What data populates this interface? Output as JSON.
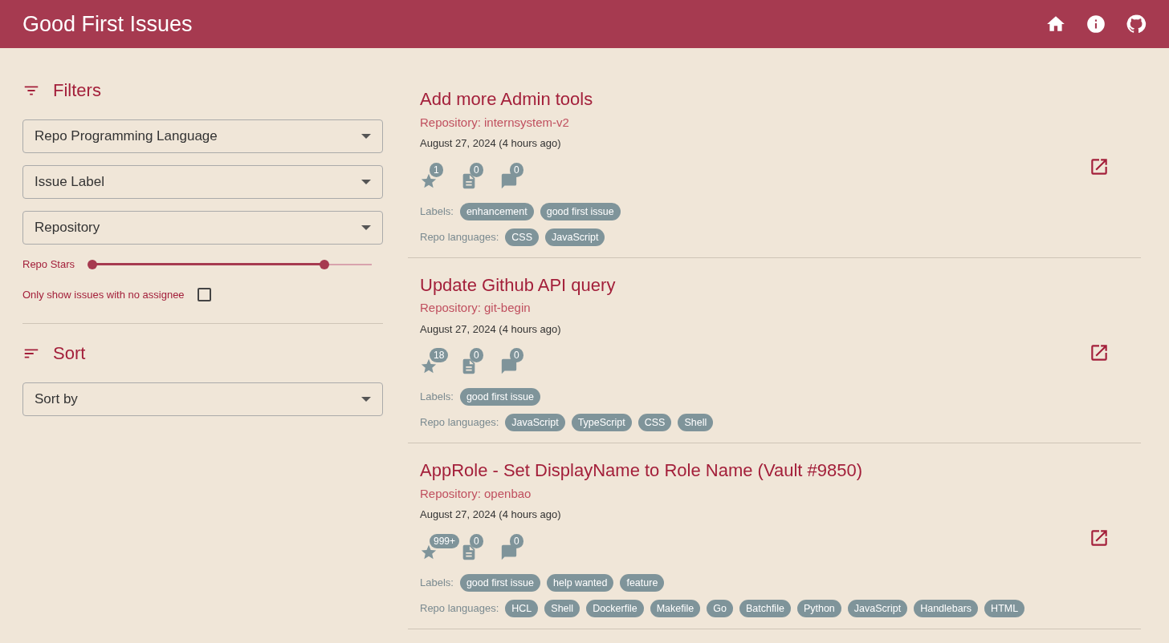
{
  "app_title": "Good First Issues",
  "filters": {
    "title": "Filters",
    "selects": [
      {
        "placeholder": "Repo Programming Language"
      },
      {
        "placeholder": "Issue Label"
      },
      {
        "placeholder": "Repository"
      }
    ],
    "stars_slider": {
      "label": "Repo Stars",
      "thumbs": [
        {
          "level": 0
        },
        {
          "level": 0.83
        }
      ]
    },
    "no_assignee": {
      "label": "Only show issues with no assignee",
      "checked": false
    }
  },
  "sort": {
    "title": "Sort",
    "select": {
      "placeholder": "Sort by"
    }
  },
  "issues": [
    {
      "title": "Add more Admin tools",
      "repository": "Repository: internsystem-v2",
      "date": "August 27, 2024 (4 hours ago)",
      "stars": "1",
      "references": "0",
      "comments": "0",
      "labels_caption": "Labels:",
      "labels": [
        "enhancement",
        "good first issue"
      ],
      "languages_caption": "Repo languages:",
      "languages": [
        "CSS",
        "JavaScript"
      ]
    },
    {
      "title": "Update Github API query",
      "repository": "Repository: git-begin",
      "date": "August 27, 2024 (4 hours ago)",
      "stars": "18",
      "references": "0",
      "comments": "0",
      "labels_caption": "Labels:",
      "labels": [
        "good first issue"
      ],
      "languages_caption": "Repo languages:",
      "languages": [
        "JavaScript",
        "TypeScript",
        "CSS",
        "Shell"
      ]
    },
    {
      "title": "AppRole - Set DisplayName to Role Name (Vault #9850)",
      "repository": "Repository: openbao",
      "date": "August 27, 2024 (4 hours ago)",
      "stars": "999+",
      "references": "0",
      "comments": "0",
      "labels_caption": "Labels:",
      "labels": [
        "good first issue",
        "help wanted",
        "feature"
      ],
      "languages_caption": "Repo languages:",
      "languages": [
        "HCL",
        "Shell",
        "Dockerfile",
        "Makefile",
        "Go",
        "Batchfile",
        "Python",
        "JavaScript",
        "Handlebars",
        "HTML"
      ]
    }
  ]
}
